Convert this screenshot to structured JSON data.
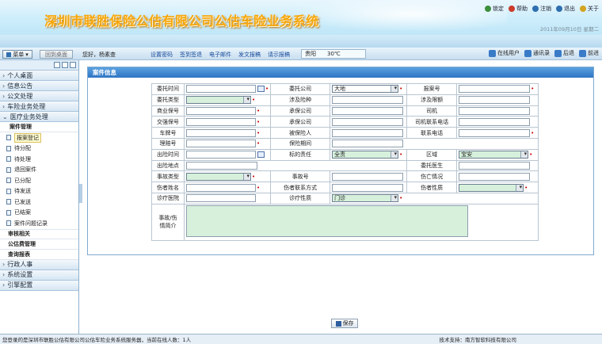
{
  "header": {
    "title": "深圳市联胜保险公估有限公司公估车险业务系统",
    "date": "2011年09月10日 星期二",
    "links": [
      {
        "label": "锁定",
        "icon": "lock-icon",
        "color": "#3d8f3d"
      },
      {
        "label": "帮助",
        "icon": "help-icon",
        "color": "#cc3a2a"
      },
      {
        "label": "注销",
        "icon": "logout-icon",
        "color": "#2f6fb0"
      },
      {
        "label": "退出",
        "icon": "exit-icon",
        "color": "#2f6fb0"
      },
      {
        "label": "关于",
        "icon": "about-icon",
        "color": "#d4a420"
      }
    ]
  },
  "nav": {
    "menu_label": "菜单",
    "desktop_label": "回到桌面",
    "greeting": "您好，杨素查",
    "quick_links": [
      "设置密码",
      "签到签退",
      "电子邮件",
      "发文报稿",
      "请示报稿"
    ],
    "weather_city": "贵阳",
    "weather_temp": "30℃",
    "right": [
      "在线用户",
      "通讯录",
      "后退",
      "前进"
    ]
  },
  "sidebar": {
    "groups_top": [
      "个人桌面",
      "信息公告",
      "公文处理",
      "车险业务处理",
      "医疗业务处理"
    ],
    "sub_title": "案件管理",
    "items": [
      "报案登记",
      "待分配",
      "待处理",
      "退回案件",
      "已分配",
      "待发送",
      "已发送",
      "已结案",
      "案件问题记录"
    ],
    "subs_after": [
      "审核相关",
      "公估费管理",
      "查询报表"
    ],
    "groups_bottom": [
      "行政人事",
      "系统设置",
      "引擎配置"
    ]
  },
  "panel": {
    "title": "案件信息",
    "save": "保存"
  },
  "form": {
    "r1": {
      "l1": "委托时间",
      "l2": "委托公司",
      "v2": "大地",
      "l3": "报案号"
    },
    "r2": {
      "l1": "委托类型",
      "l2": "涉及险种",
      "l3": "涉及限额"
    },
    "r3": {
      "l1": "商业保号",
      "l2": "承保公司",
      "l3": "司机"
    },
    "r4": {
      "l1": "交强保号",
      "l2": "承保公司",
      "l3": "司机联系电话"
    },
    "r5": {
      "l1": "车牌号",
      "l2": "被保险人",
      "l3": "联系电话"
    },
    "r6": {
      "l1": "理赔号",
      "l2": "保险期间"
    },
    "r7": {
      "l1": "出险时间",
      "l2": "标的责任",
      "v2": "全责",
      "l3": "区域",
      "v3": "宝安"
    },
    "r8": {
      "l1": "出险地点",
      "l3": "委托医生"
    },
    "r9": {
      "l1": "事故类型",
      "l2": "事故号",
      "l3": "伤亡情况"
    },
    "r10": {
      "l1": "伤者姓名",
      "l2": "伤者联系方式",
      "l3": "伤者性质"
    },
    "r11": {
      "l1": "诊疗医院",
      "l2": "诊疗性质",
      "v2": "门诊"
    },
    "r12": {
      "l1": "事故/伤情简介"
    }
  },
  "status": {
    "left": "您登录的是深圳市联胜公估有限公司公估车险业务系统服务器，当前在线人数：1人",
    "right": "技术支持：南方智软科技有限公司"
  }
}
